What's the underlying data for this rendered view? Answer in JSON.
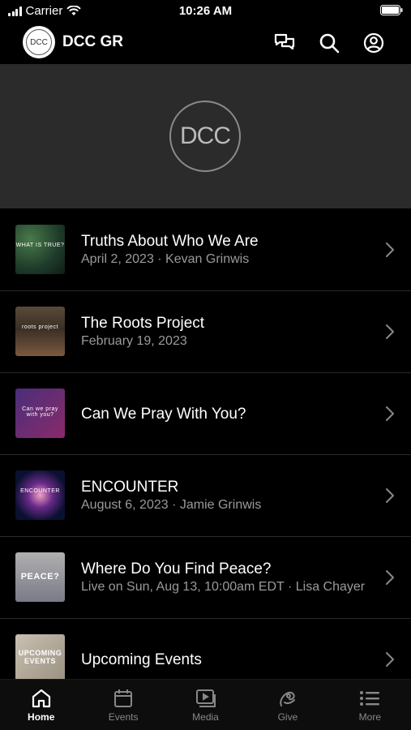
{
  "status_bar": {
    "carrier": "Carrier",
    "time": "10:26 AM"
  },
  "header": {
    "logo_text": "DCC",
    "title": "DCC GR"
  },
  "hero": {
    "logo_text": "DCC"
  },
  "items": [
    {
      "title": "Truths About Who We Are",
      "subtitle": "April 2, 2023 · Kevan Grinwis",
      "thumb_text": "WHAT IS TRUE?"
    },
    {
      "title": "The Roots Project",
      "subtitle": "February 19, 2023",
      "thumb_text": "roots project"
    },
    {
      "title": "Can We Pray With You?",
      "subtitle": "",
      "thumb_text": "Can we pray with you?"
    },
    {
      "title": "ENCOUNTER",
      "subtitle": "August 6, 2023 · Jamie Grinwis",
      "thumb_text": "ENCOUNTER"
    },
    {
      "title": "Where Do You Find Peace?",
      "subtitle": "Live on Sun, Aug 13, 10:00am EDT · Lisa Chayer",
      "thumb_text": "PEACE?"
    },
    {
      "title": "Upcoming Events",
      "subtitle": "",
      "thumb_text": "UPCOMING EVENTS"
    }
  ],
  "tabs": [
    {
      "label": "Home",
      "icon": "home-icon",
      "active": true
    },
    {
      "label": "Events",
      "icon": "calendar-icon",
      "active": false
    },
    {
      "label": "Media",
      "icon": "media-icon",
      "active": false
    },
    {
      "label": "Give",
      "icon": "give-icon",
      "active": false
    },
    {
      "label": "More",
      "icon": "list-icon",
      "active": false
    }
  ],
  "colors": {
    "background": "#000000",
    "hero": "#2b2b2b",
    "subtitle": "#9a9a9a",
    "tab_inactive": "#888888"
  }
}
